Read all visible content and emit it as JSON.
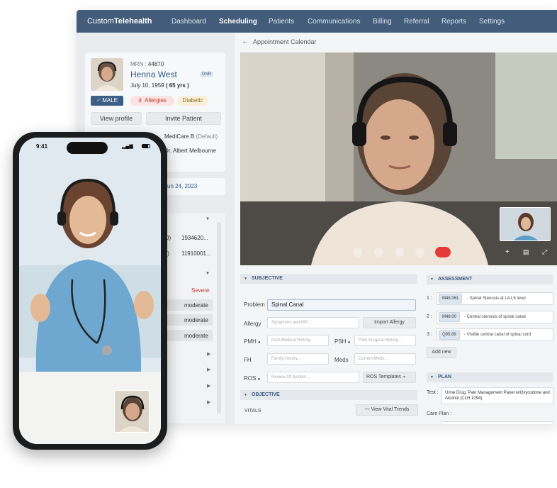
{
  "app": {
    "brand_prefix": "Custom",
    "brand_suffix": "Telehealth"
  },
  "nav": {
    "items": [
      "Dashboard",
      "Scheduling",
      "Patients",
      "Communications",
      "Billing",
      "Referral",
      "Reports",
      "Settings"
    ],
    "active": "Scheduling"
  },
  "patient": {
    "mrn_label": "MRN",
    "mrn": "44870",
    "name": "Henna West",
    "badge": "DNR",
    "dob": "July 10, 1959",
    "age": "( 65 yrs )",
    "gender": "♂ MALE",
    "allergies_count": "4",
    "allergies_label": "Allergies",
    "condition": "Diabetic",
    "view_profile": "View profile",
    "invite": "Invite Patient",
    "insurance": "MediCare B",
    "insurance_note": "(Default)",
    "doctor": "Dr. Albert Melbourne",
    "appt_date": "Fri , Jun 24, 2023"
  },
  "left_list": {
    "ids": [
      "1934620...",
      "11910001..."
    ],
    "id_prefixes": [
      "0)",
      "I)"
    ],
    "severity": [
      "Severe",
      "moderate",
      "moderate",
      "moderate"
    ]
  },
  "calendar": {
    "title": "Appointment Calendar"
  },
  "subjective": {
    "header": "SUBJECTIVE",
    "problem_label": "Problem",
    "problem_value": "Spinal Canal",
    "allergy_label": "Allergy",
    "allergy_placeholder": "Symptoms and HPI...",
    "import_allergy": "Import Allergy",
    "pmh_label": "PMH",
    "pmh_placeholder": "Past Medical History...",
    "psh_label": "PSH",
    "psh_placeholder": "Past Surgical History...",
    "fh_label": "FH",
    "fh_placeholder": "Family history...",
    "meds_label": "Meds",
    "meds_placeholder": "Current Meds...",
    "ros_label": "ROS",
    "ros_placeholder": "Review Of System...",
    "ros_templates": "ROS Templates"
  },
  "objective": {
    "header": "OBJECTIVE",
    "vitals": "VITALS",
    "vital_trends": "View Vital Trends"
  },
  "assessment": {
    "header": "ASSESSMENT",
    "items": [
      {
        "num": "1 :",
        "code": "M48.061",
        "desc": "- Spinal Stenosis at L4-L5 level"
      },
      {
        "num": "2 :",
        "code": "M48.00",
        "desc": "- Central stenosis of spinal canal"
      },
      {
        "num": "3 :",
        "code": "Q95.89",
        "desc": "- Visible central canal of spinal cord"
      }
    ],
    "add_new": "Add new"
  },
  "plan": {
    "header": "PLAN",
    "test_label": "Test :",
    "test_value": "Urine Drug, Pain Management Panel w/Oxycodone and Alcohol (CLH 1094)",
    "care_plan_label": "Care Plan :"
  },
  "phone": {
    "time": "9:41"
  },
  "colors": {
    "nav": "#425c7a",
    "accent": "#2d5a8c",
    "end_call": "#e53935",
    "allergy": "#c0392b"
  }
}
